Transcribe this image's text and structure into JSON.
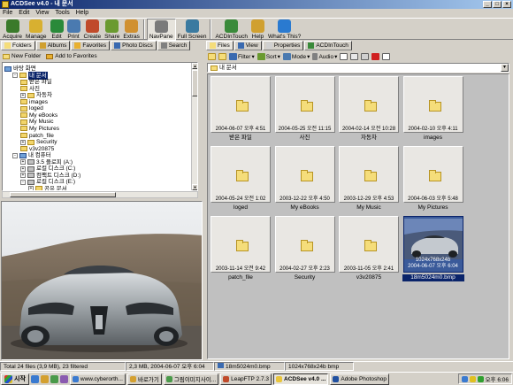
{
  "window": {
    "title": "ACDSee v4.0 - 내 문서"
  },
  "menu": [
    "File",
    "Edit",
    "View",
    "Tools",
    "Help"
  ],
  "toolbar": {
    "buttons": [
      {
        "label": "Acquire",
        "icon": "acquire-icon",
        "color": "#3a7a2a"
      },
      {
        "label": "Manage",
        "icon": "manage-icon",
        "color": "#d8b030"
      },
      {
        "label": "Edit",
        "icon": "edit-icon",
        "color": "#2a8a3a"
      },
      {
        "label": "Print",
        "icon": "print-icon",
        "color": "#4a7ab0"
      },
      {
        "label": "Create",
        "icon": "create-icon",
        "color": "#c04a2a"
      },
      {
        "label": "Share",
        "icon": "share-icon",
        "color": "#6a9a30"
      },
      {
        "label": "Extras",
        "icon": "extras-icon",
        "color": "#d09030"
      },
      {
        "label": "NavPane",
        "icon": "navpane-icon",
        "color": "#7a7a7a"
      },
      {
        "label": "Full Screen",
        "icon": "fullscreen-icon",
        "color": "#3a7aa0"
      },
      {
        "label": "ACDInTouch",
        "icon": "acdintouch-icon",
        "color": "#3a8a3a"
      },
      {
        "label": "Help",
        "icon": "help-icon",
        "color": "#d0a030"
      },
      {
        "label": "What's This?",
        "icon": "whats-this-icon",
        "color": "#2a7ad0"
      }
    ]
  },
  "left": {
    "tabs": [
      "Folders",
      "Albums",
      "Favorites",
      "Photo Discs",
      "Search"
    ],
    "new_folder": "New Folder",
    "add_favorites": "Add to Favorites",
    "tree": [
      {
        "label": "바탕 화면",
        "level": 0,
        "type": "pc",
        "exp": ""
      },
      {
        "label": "내 문서",
        "level": 1,
        "type": "folder",
        "exp": "-",
        "selected": true
      },
      {
        "label": "받은 파일",
        "level": 2,
        "type": "folder",
        "exp": ""
      },
      {
        "label": "사진",
        "level": 2,
        "type": "folder",
        "exp": ""
      },
      {
        "label": "자동차",
        "level": 2,
        "type": "folder",
        "exp": "+"
      },
      {
        "label": "images",
        "level": 2,
        "type": "folder",
        "exp": ""
      },
      {
        "label": "loged",
        "level": 2,
        "type": "folder",
        "exp": ""
      },
      {
        "label": "My eBooks",
        "level": 2,
        "type": "folder",
        "exp": ""
      },
      {
        "label": "My Music",
        "level": 2,
        "type": "folder",
        "exp": ""
      },
      {
        "label": "My Pictures",
        "level": 2,
        "type": "folder",
        "exp": ""
      },
      {
        "label": "patch_file",
        "level": 2,
        "type": "folder",
        "exp": ""
      },
      {
        "label": "Security",
        "level": 2,
        "type": "folder",
        "exp": "+"
      },
      {
        "label": "v3v20875",
        "level": 2,
        "type": "folder",
        "exp": ""
      },
      {
        "label": "내 컴퓨터",
        "level": 1,
        "type": "pc",
        "exp": "-"
      },
      {
        "label": "3.5 플로피 (A:)",
        "level": 2,
        "type": "drive",
        "exp": "+"
      },
      {
        "label": "로컬 디스크 (C:)",
        "level": 2,
        "type": "drive",
        "exp": "+"
      },
      {
        "label": "컴팩트 디스크 (D:)",
        "level": 2,
        "type": "drive",
        "exp": "+"
      },
      {
        "label": "로컬 디스크 (E:)",
        "level": 2,
        "type": "drive",
        "exp": "-"
      },
      {
        "label": "공유 문서",
        "level": 3,
        "type": "folder",
        "exp": "+"
      }
    ]
  },
  "right": {
    "tabs": [
      "Files",
      "View",
      "Properties",
      "ACDInTouch"
    ],
    "filter": "Filter",
    "sort": "Sort",
    "mode": "Mode",
    "audio": "Audio",
    "address": "내 문서",
    "items": [
      {
        "name": "받은 파일",
        "date": "2004-06-07 오후 4:51",
        "type": "folder"
      },
      {
        "name": "사진",
        "date": "2004-05-25 오전 11:15",
        "type": "folder"
      },
      {
        "name": "자동차",
        "date": "2004-02-14 오전 10:28",
        "type": "folder"
      },
      {
        "name": "images",
        "date": "2004-02-10 오후 4:11",
        "type": "folder"
      },
      {
        "name": "loged",
        "date": "2004-05-24 오전 1:02",
        "type": "folder"
      },
      {
        "name": "My eBooks",
        "date": "2003-12-22 오후 4:50",
        "type": "folder"
      },
      {
        "name": "My Music",
        "date": "2003-12-29 오후 4:53",
        "type": "folder"
      },
      {
        "name": "My Pictures",
        "date": "2004-06-03 오후 5:48",
        "type": "folder"
      },
      {
        "name": "patch_file",
        "date": "2003-11-14 오전 9:42",
        "type": "folder"
      },
      {
        "name": "Security",
        "date": "2004-02-27 오후 2:23",
        "type": "folder"
      },
      {
        "name": "v3v20875",
        "date": "2003-11-05 오후 2:41",
        "type": "folder"
      },
      {
        "name": "18m5024m0.bmp",
        "date": "2004-06-07 오후 6:04",
        "type": "image",
        "info": "1024x768x24b",
        "selected": true
      }
    ]
  },
  "status": {
    "total": "Total 24 files (3,9 MB), 23 filtered",
    "size": "2,3 MB, 2004-06-07 오후 6:04",
    "file": "18m5024m0.bmp",
    "dims": "1024x768x24b bmp"
  },
  "taskbar": {
    "start": "시작",
    "tasks": [
      {
        "label": "www.cyberorth...",
        "active": false
      },
      {
        "label": "바로가기",
        "active": false
      },
      {
        "label": "그림이미지사이...",
        "active": false
      },
      {
        "label": "LeapFTP 2.7.3",
        "active": false
      },
      {
        "label": "ACDSee v4.0 ...",
        "active": true
      },
      {
        "label": "Adobe Photoshop",
        "active": false
      }
    ],
    "clock": "오후 6:06"
  }
}
